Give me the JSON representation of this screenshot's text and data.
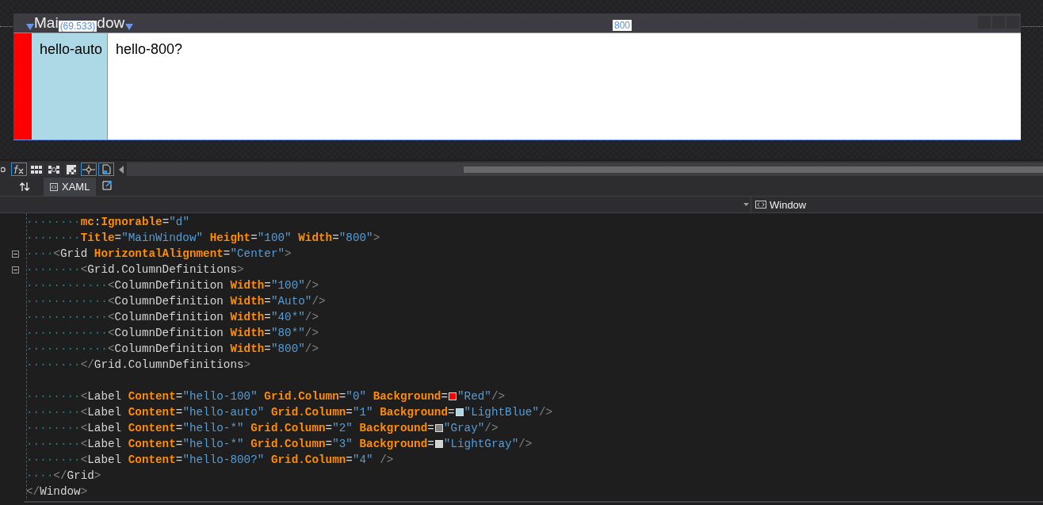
{
  "designer": {
    "window": {
      "title_start": "Mai",
      "title_end": "dow"
    },
    "rulers": [
      {
        "text": "(69.533)"
      },
      {
        "text": "800"
      }
    ],
    "columns": [
      {
        "kind": "fixed",
        "color": "#ff0000"
      },
      {
        "kind": "auto",
        "color": "#add8e6",
        "text": "hello-auto"
      },
      {
        "kind": "fill",
        "color": "#ffffff",
        "text": "hello-800?"
      }
    ]
  },
  "toolbar": [
    {
      "kind": "refresh",
      "selected": false
    },
    {
      "kind": "fx",
      "selected": true
    },
    {
      "kind": "grid",
      "selected": false
    },
    {
      "kind": "snap",
      "selected": false
    },
    {
      "kind": "checker",
      "selected": false
    },
    {
      "kind": "crosshair",
      "selected": true
    },
    {
      "kind": "file",
      "selected": true
    }
  ],
  "tabs": [
    {
      "label": "XAML",
      "selected": true
    }
  ],
  "nav": {
    "right": "Window"
  },
  "code": [
    {
      "ws": "········",
      "expander": false,
      "tokens": [
        {
          "kind": "attr",
          "text": "mc"
        },
        {
          "kind": "op",
          "text": ":"
        },
        {
          "kind": "attr",
          "text": "Ignorable"
        },
        {
          "kind": "op",
          "text": "="
        },
        {
          "kind": "val",
          "text": "\"d\""
        }
      ]
    },
    {
      "ws": "········",
      "expander": false,
      "tokens": [
        {
          "kind": "attr",
          "text": "Title"
        },
        {
          "kind": "op",
          "text": "="
        },
        {
          "kind": "val",
          "text": "\"MainWindow\" "
        },
        {
          "kind": "attr",
          "text": "Height"
        },
        {
          "kind": "op",
          "text": "="
        },
        {
          "kind": "val",
          "text": "\"100\" "
        },
        {
          "kind": "attr",
          "text": "Width"
        },
        {
          "kind": "op",
          "text": "="
        },
        {
          "kind": "val",
          "text": "\"800\""
        },
        {
          "kind": "punct",
          "text": ">"
        }
      ]
    },
    {
      "ws": "····",
      "expander": true,
      "tokens": [
        {
          "kind": "punct",
          "text": "<"
        },
        {
          "kind": "name",
          "text": "Grid "
        },
        {
          "kind": "attr",
          "text": "HorizontalAlignment"
        },
        {
          "kind": "op",
          "text": "="
        },
        {
          "kind": "val",
          "text": "\"Center\""
        },
        {
          "kind": "punct",
          "text": ">"
        }
      ]
    },
    {
      "ws": "········",
      "expander": true,
      "tokens": [
        {
          "kind": "punct",
          "text": "<"
        },
        {
          "kind": "name",
          "text": "Grid.ColumnDefinitions"
        },
        {
          "kind": "punct",
          "text": ">"
        }
      ]
    },
    {
      "ws": "············",
      "expander": false,
      "tokens": [
        {
          "kind": "punct",
          "text": "<"
        },
        {
          "kind": "name",
          "text": "ColumnDefinition "
        },
        {
          "kind": "attr",
          "text": "Width"
        },
        {
          "kind": "op",
          "text": "="
        },
        {
          "kind": "val",
          "text": "\"100\""
        },
        {
          "kind": "punct",
          "text": "/>"
        }
      ]
    },
    {
      "ws": "············",
      "expander": false,
      "tokens": [
        {
          "kind": "punct",
          "text": "<"
        },
        {
          "kind": "name",
          "text": "ColumnDefinition "
        },
        {
          "kind": "attr",
          "text": "Width"
        },
        {
          "kind": "op",
          "text": "="
        },
        {
          "kind": "val",
          "text": "\"Auto\""
        },
        {
          "kind": "punct",
          "text": "/>"
        }
      ]
    },
    {
      "ws": "············",
      "expander": false,
      "tokens": [
        {
          "kind": "punct",
          "text": "<"
        },
        {
          "kind": "name",
          "text": "ColumnDefinition "
        },
        {
          "kind": "attr",
          "text": "Width"
        },
        {
          "kind": "op",
          "text": "="
        },
        {
          "kind": "val",
          "text": "\"40*\""
        },
        {
          "kind": "punct",
          "text": "/>"
        }
      ]
    },
    {
      "ws": "············",
      "expander": false,
      "tokens": [
        {
          "kind": "punct",
          "text": "<"
        },
        {
          "kind": "name",
          "text": "ColumnDefinition "
        },
        {
          "kind": "attr",
          "text": "Width"
        },
        {
          "kind": "op",
          "text": "="
        },
        {
          "kind": "val",
          "text": "\"80*\""
        },
        {
          "kind": "punct",
          "text": "/>"
        }
      ]
    },
    {
      "ws": "············",
      "expander": false,
      "tokens": [
        {
          "kind": "punct",
          "text": "<"
        },
        {
          "kind": "name",
          "text": "ColumnDefinition "
        },
        {
          "kind": "attr",
          "text": "Width"
        },
        {
          "kind": "op",
          "text": "="
        },
        {
          "kind": "val",
          "text": "\"800\""
        },
        {
          "kind": "punct",
          "text": "/>"
        }
      ]
    },
    {
      "ws": "········",
      "expander": false,
      "tokens": [
        {
          "kind": "punct",
          "text": "</"
        },
        {
          "kind": "name",
          "text": "Grid.ColumnDefinitions"
        },
        {
          "kind": "punct",
          "text": ">"
        }
      ]
    },
    {
      "expander": false
    },
    {
      "ws": "········",
      "expander": false,
      "tokens": [
        {
          "kind": "punct",
          "text": "<"
        },
        {
          "kind": "name",
          "text": "Label "
        },
        {
          "kind": "attr",
          "text": "Content"
        },
        {
          "kind": "op",
          "text": "="
        },
        {
          "kind": "val",
          "text": "\"hello-100\" "
        },
        {
          "kind": "attr",
          "text": "Grid.Column"
        },
        {
          "kind": "op",
          "text": "="
        },
        {
          "kind": "val",
          "text": "\"0\" "
        },
        {
          "kind": "attr",
          "text": "Background"
        },
        {
          "kind": "op",
          "text": "="
        },
        {
          "kind": "swatch",
          "color": "#ff0000"
        },
        {
          "kind": "val",
          "text": "\"Red\""
        },
        {
          "kind": "punct",
          "text": "/>"
        }
      ]
    },
    {
      "ws": "········",
      "expander": false,
      "tokens": [
        {
          "kind": "punct",
          "text": "<"
        },
        {
          "kind": "name",
          "text": "Label "
        },
        {
          "kind": "attr",
          "text": "Content"
        },
        {
          "kind": "op",
          "text": "="
        },
        {
          "kind": "val",
          "text": "\"hello-auto\" "
        },
        {
          "kind": "attr",
          "text": "Grid.Column"
        },
        {
          "kind": "op",
          "text": "="
        },
        {
          "kind": "val",
          "text": "\"1\" "
        },
        {
          "kind": "attr",
          "text": "Background"
        },
        {
          "kind": "op",
          "text": "="
        },
        {
          "kind": "swatch",
          "color": "#add8e6"
        },
        {
          "kind": "val",
          "text": "\"LightBlue\""
        },
        {
          "kind": "punct",
          "text": "/>"
        }
      ]
    },
    {
      "ws": "········",
      "expander": false,
      "tokens": [
        {
          "kind": "punct",
          "text": "<"
        },
        {
          "kind": "name",
          "text": "Label "
        },
        {
          "kind": "attr",
          "text": "Content"
        },
        {
          "kind": "op",
          "text": "="
        },
        {
          "kind": "val",
          "text": "\"hello-*\" "
        },
        {
          "kind": "attr",
          "text": "Grid.Column"
        },
        {
          "kind": "op",
          "text": "="
        },
        {
          "kind": "val",
          "text": "\"2\" "
        },
        {
          "kind": "attr",
          "text": "Background"
        },
        {
          "kind": "op",
          "text": "="
        },
        {
          "kind": "swatch",
          "color": "#808080"
        },
        {
          "kind": "val",
          "text": "\"Gray\""
        },
        {
          "kind": "punct",
          "text": "/>"
        }
      ]
    },
    {
      "ws": "········",
      "expander": false,
      "tokens": [
        {
          "kind": "punct",
          "text": "<"
        },
        {
          "kind": "name",
          "text": "Label "
        },
        {
          "kind": "attr",
          "text": "Content"
        },
        {
          "kind": "op",
          "text": "="
        },
        {
          "kind": "val",
          "text": "\"hello-*\" "
        },
        {
          "kind": "attr",
          "text": "Grid.Column"
        },
        {
          "kind": "op",
          "text": "="
        },
        {
          "kind": "val",
          "text": "\"3\" "
        },
        {
          "kind": "attr",
          "text": "Background"
        },
        {
          "kind": "op",
          "text": "="
        },
        {
          "kind": "swatch",
          "color": "#d3d3d3"
        },
        {
          "kind": "val",
          "text": "\"LightGray\""
        },
        {
          "kind": "punct",
          "text": "/>"
        }
      ]
    },
    {
      "ws": "········",
      "expander": false,
      "tokens": [
        {
          "kind": "punct",
          "text": "<"
        },
        {
          "kind": "name",
          "text": "Label "
        },
        {
          "kind": "attr",
          "text": "Content"
        },
        {
          "kind": "op",
          "text": "="
        },
        {
          "kind": "val",
          "text": "\"hello-800?\" "
        },
        {
          "kind": "attr",
          "text": "Grid.Column"
        },
        {
          "kind": "op",
          "text": "="
        },
        {
          "kind": "val",
          "text": "\"4\" "
        },
        {
          "kind": "punct",
          "text": "/>"
        }
      ]
    },
    {
      "ws": "····",
      "expander": false,
      "tokens": [
        {
          "kind": "punct",
          "text": "</"
        },
        {
          "kind": "name",
          "text": "Grid"
        },
        {
          "kind": "punct",
          "text": ">"
        }
      ]
    },
    {
      "expander": false,
      "tokens": [
        {
          "kind": "punct",
          "text": "</"
        },
        {
          "kind": "name",
          "text": "Window"
        },
        {
          "kind": "punct",
          "text": ">"
        }
      ]
    }
  ]
}
